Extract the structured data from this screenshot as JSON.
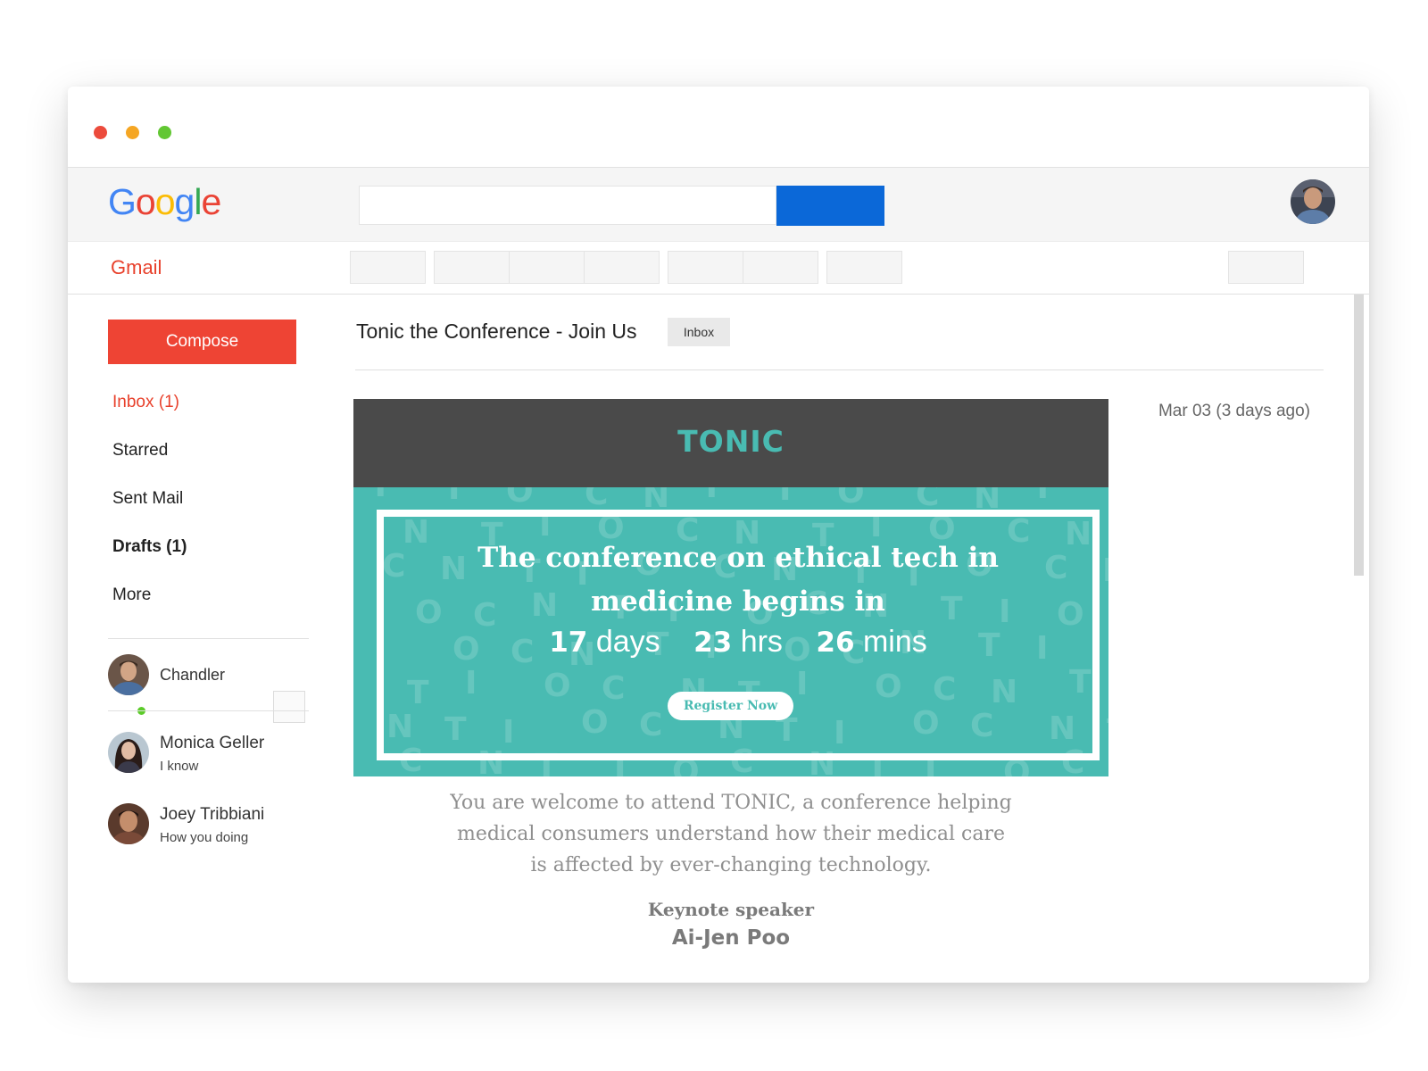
{
  "window": {
    "traffic_lights": [
      {
        "name": "close",
        "color": "#ec4b3c"
      },
      {
        "name": "minimize",
        "color": "#f5a623"
      },
      {
        "name": "maximize",
        "color": "#62c733"
      }
    ]
  },
  "topbar": {
    "logo_letters": [
      {
        "char": "G",
        "color": "#4285f4"
      },
      {
        "char": "o",
        "color": "#ea4335"
      },
      {
        "char": "o",
        "color": "#fbbc05"
      },
      {
        "char": "g",
        "color": "#4285f4"
      },
      {
        "char": "l",
        "color": "#34a853"
      },
      {
        "char": "e",
        "color": "#ea4335"
      }
    ],
    "search_value": "",
    "search_button_color": "#0b68d8",
    "avatar_icon": "user-avatar"
  },
  "gmailbar": {
    "label": "Gmail",
    "label_color": "#e8412c"
  },
  "sidebar": {
    "compose_label": "Compose",
    "compose_color": "#ee4434",
    "nav": [
      {
        "label": "Inbox (1)",
        "active": true
      },
      {
        "label": "Starred"
      },
      {
        "label": "Sent Mail"
      },
      {
        "label": "Drafts (1)"
      },
      {
        "label": "More"
      }
    ],
    "active_color": "#e8412c",
    "online_contact": {
      "name": "Chandler",
      "status_color": "#5ccb2a"
    },
    "chats": [
      {
        "name": "Monica Geller",
        "snippet": "I know"
      },
      {
        "name": "Joey Tribbiani",
        "snippet": "How you doing"
      }
    ]
  },
  "message": {
    "subject": "Tonic the Conference - Join Us",
    "label": "Inbox",
    "date": "Mar 03 (3 days ago)",
    "email": {
      "logo": "TONIC",
      "header_color": "#4a4a4a",
      "brand_color": "#49bbb2",
      "headline_line1": "The conference on ethical tech in",
      "headline_line2": "medicine begins in",
      "countdown": {
        "days": "17",
        "days_unit": "days",
        "hrs": "23",
        "hrs_unit": "hrs",
        "mins": "26",
        "mins_unit": "mins"
      },
      "register_label": "Register Now",
      "body_line1": "You are welcome to attend TONIC, a conference helping",
      "body_line2": "medical consumers understand how their medical care",
      "body_line3": "is affected by ever-changing technology.",
      "keynote_label": "Keynote speaker",
      "speaker": "Ai-Jen Poo"
    }
  }
}
